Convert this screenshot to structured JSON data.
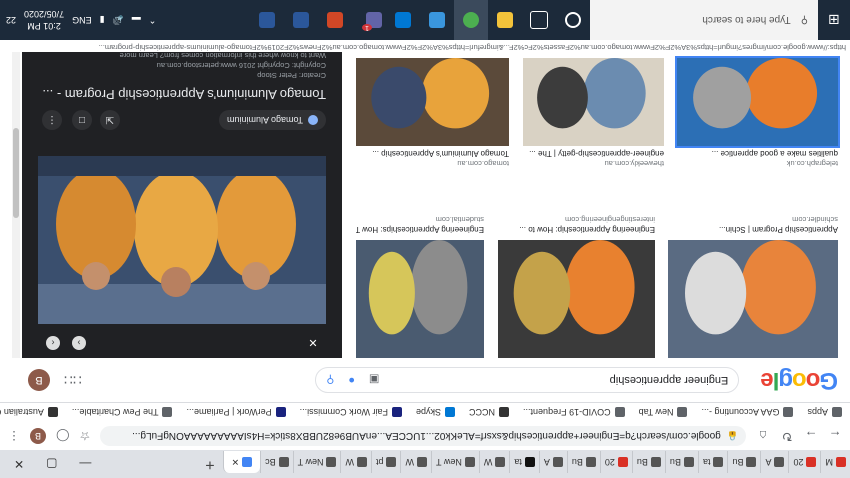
{
  "tabs": [
    {
      "label": "M",
      "color": "#d93025"
    },
    {
      "label": "20",
      "color": "#d93025"
    },
    {
      "label": "A",
      "color": "#555555"
    },
    {
      "label": "Bu",
      "color": "#555555"
    },
    {
      "label": "ta",
      "color": "#555555"
    },
    {
      "label": "Bu",
      "color": "#555555"
    },
    {
      "label": "Bu",
      "color": "#555555"
    },
    {
      "label": "20",
      "color": "#d93025"
    },
    {
      "label": "Bu",
      "color": "#555555"
    },
    {
      "label": "A",
      "color": "#555555"
    },
    {
      "label": "ta",
      "color": "#111111"
    },
    {
      "label": "W",
      "color": "#555555"
    },
    {
      "label": "New T",
      "color": "#555555"
    },
    {
      "label": "W",
      "color": "#555555"
    },
    {
      "label": "pt",
      "color": "#555555"
    },
    {
      "label": "W",
      "color": "#555555"
    },
    {
      "label": "New T",
      "color": "#555555"
    },
    {
      "label": "Bc",
      "color": "#555555"
    }
  ],
  "active_tab": {
    "label": "",
    "close": "✕"
  },
  "new_tab": "+",
  "window_controls": {
    "minimize": "—",
    "maximize": "▢",
    "close": "✕"
  },
  "url": "google.com/search?q=Engineer+apprenticeship&sxsrf=ALeKk02...1UCCEA...enAUB9e82UBBX8stick=H4sIAAAAAAAAAONgFuLg...",
  "bookmarks": [
    {
      "label": "Apps",
      "color": "#5f6368"
    },
    {
      "label": "GAA Accounting -...",
      "color": "#5f6368"
    },
    {
      "label": "New Tab",
      "color": "#5f6368"
    },
    {
      "label": "COVID-19 Frequent...",
      "color": "#5f6368"
    },
    {
      "label": "NCCC",
      "color": "#333333"
    },
    {
      "label": "Skype",
      "color": "#0078d4"
    },
    {
      "label": "Fair Work Commissi...",
      "color": "#1a237e"
    },
    {
      "label": "PerWork | Parliame...",
      "color": "#1a237e"
    },
    {
      "label": "The Pew Charitable...",
      "color": "#5f6368"
    },
    {
      "label": "Australian Governm...",
      "color": "#333333"
    }
  ],
  "search": {
    "query": "Engineer apprenticeship",
    "logo": [
      "G",
      "o",
      "o",
      "g",
      "l",
      "e"
    ]
  },
  "profile_initial": "B",
  "results_top": [
    {
      "caption": "Tomago Aluminium's Apprenticeship ...",
      "domain": "tomago.com.au",
      "colors": [
        "#e8a33b",
        "#5b4a3a",
        "#3a4a6b"
      ]
    },
    {
      "caption": "engineer-apprenticeship-getty | The ...",
      "domain": "theweekly.com.au",
      "colors": [
        "#6b8cb0",
        "#d9d2c4",
        "#3c3c3c"
      ]
    },
    {
      "caption": "qualities make a good apprentice ...",
      "domain": "telegraph.co.uk",
      "colors": [
        "#e87d2b",
        "#2c6fb5",
        "#a0a0a0"
      ]
    }
  ],
  "results_bottom": [
    {
      "caption": "Engineering Apprenticeships: How To ...",
      "domain": "studential.com",
      "colors": [
        "#8c8c8c",
        "#4a5b70",
        "#d6c65a"
      ]
    },
    {
      "caption": "Engineering Apprenticeship: How to ...",
      "domain": "interestingengineering.com",
      "colors": [
        "#e8812f",
        "#3a3a3a",
        "#c4a24a"
      ]
    },
    {
      "caption": "Apprenticeship Program | Schin...",
      "domain": "schindler.com",
      "colors": [
        "#e8843b",
        "#5a6b82",
        "#dcdcdc"
      ]
    }
  ],
  "preview": {
    "source": "Tomago Aluminium",
    "title": "Tomago Aluminium's Apprenticeship Program - ...",
    "creator": "Creator: Peter Stoop",
    "copyright": "Copyright: Copyright 2016 www.peterstoop.com.au",
    "license_note": "Want to know where this information comes from? Learn more",
    "close": "✕"
  },
  "status_url": "https://www.google.com/imgres?imgurl=https%3A%2F%2Fwww.tomago.com.au%2Fassets%2Fc%2F...&imgrefurl=https%3A%2F%2Fwww.tomago.com.au%2Fnews%2F2019%2Ftomago-aluminiums-apprenticeship-program...",
  "taskbar": {
    "search_placeholder": "Type here to search",
    "apps": [
      {
        "name": "cortana",
        "color": "#ffffff"
      },
      {
        "name": "task-view",
        "color": "#ffffff"
      },
      {
        "name": "file-explorer",
        "color": "#f3c33a"
      },
      {
        "name": "chrome",
        "color": "#4caf50"
      },
      {
        "name": "edge",
        "color": "#3a96dd"
      },
      {
        "name": "outlook",
        "color": "#0078d4"
      },
      {
        "name": "teams",
        "color": "#6264a7"
      },
      {
        "name": "powerpoint",
        "color": "#d24726"
      },
      {
        "name": "word",
        "color": "#2b579a"
      },
      {
        "name": "word-2",
        "color": "#2b579a"
      }
    ],
    "badge": "1",
    "lang": "ENG",
    "time": "2:01 PM",
    "date": "7/05/2020",
    "notifications": "22"
  },
  "accent": "#4285f4"
}
